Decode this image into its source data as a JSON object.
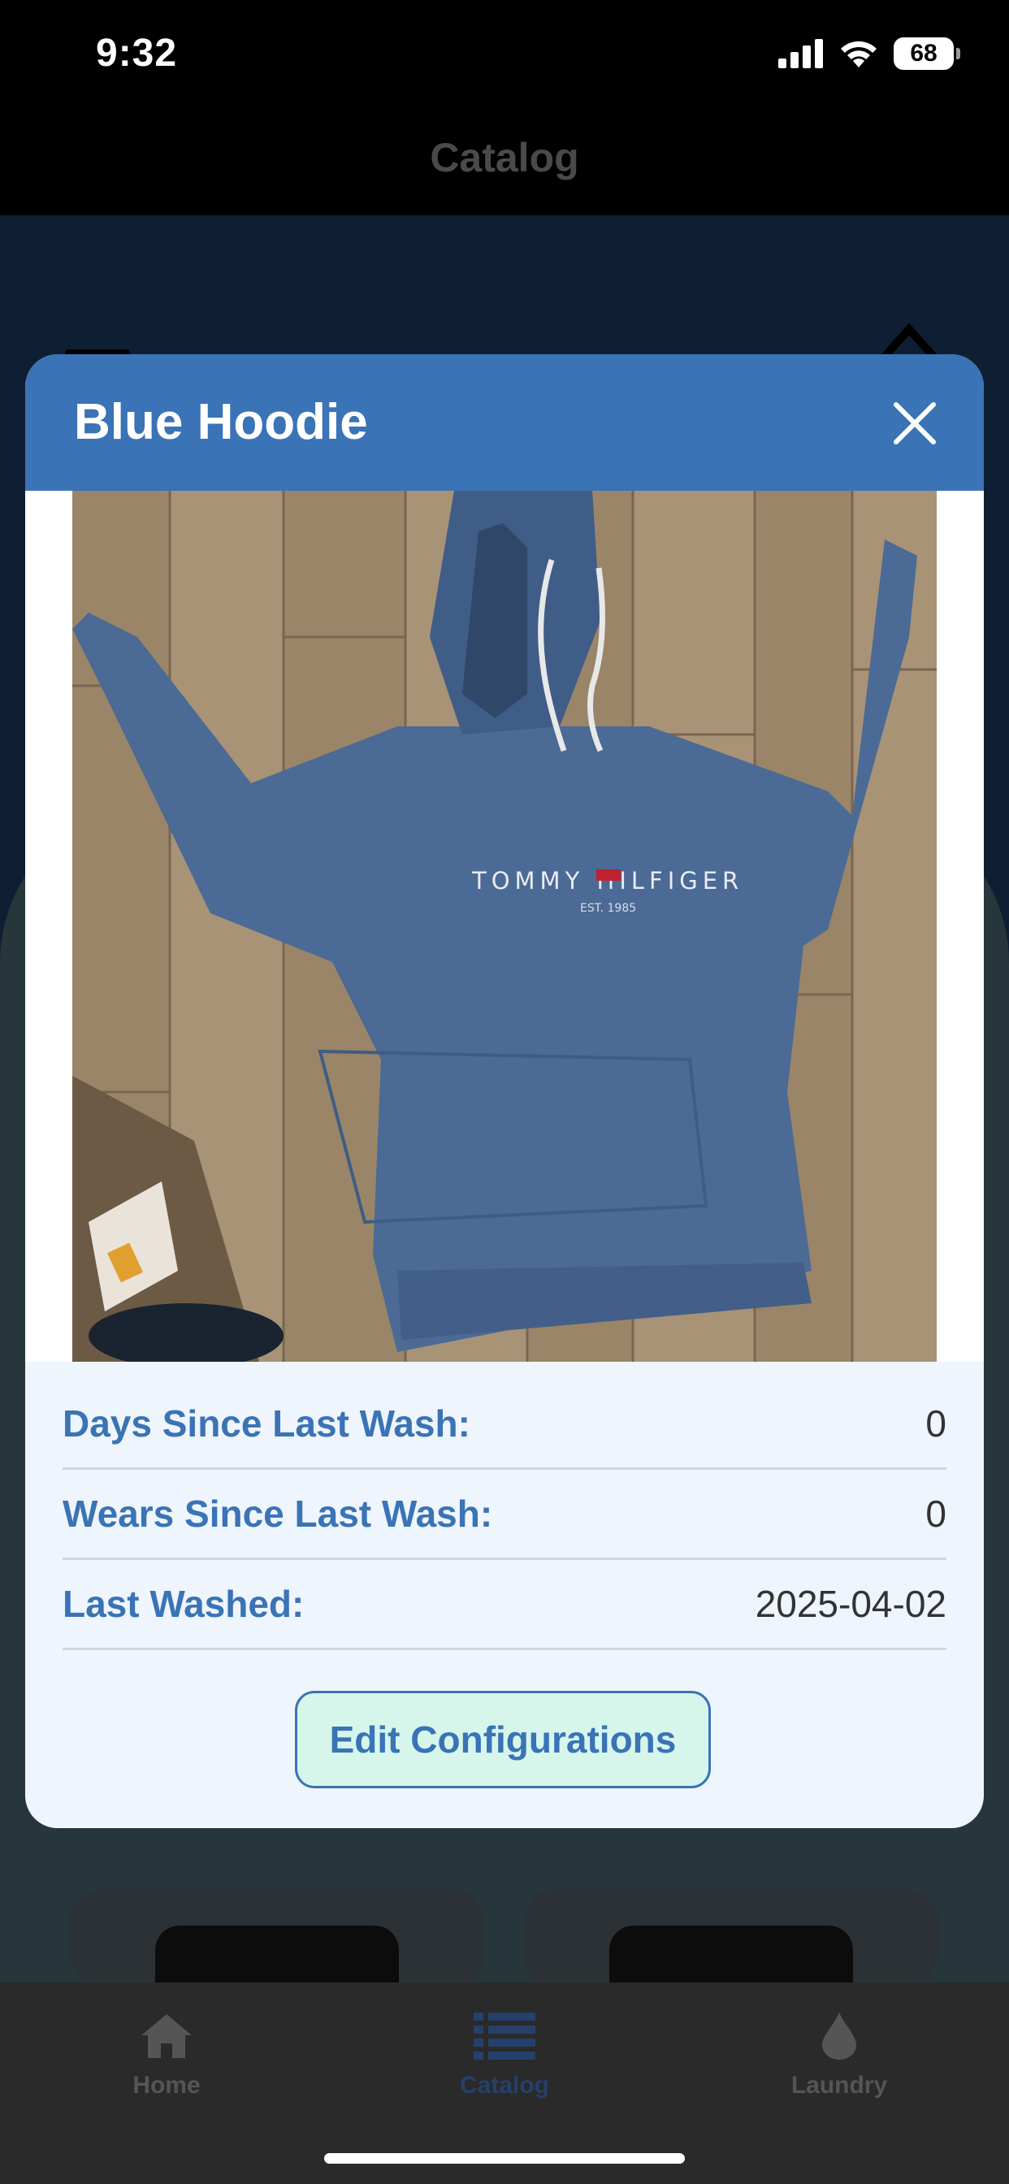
{
  "status_bar": {
    "time": "9:32",
    "battery": "68"
  },
  "nav": {
    "title": "Catalog"
  },
  "modal": {
    "title": "Blue Hoodie",
    "stats": [
      {
        "label": "Days Since Last Wash:",
        "value": "0"
      },
      {
        "label": "Wears Since Last Wash:",
        "value": "0"
      },
      {
        "label": "Last Washed:",
        "value": "2025-04-02"
      }
    ],
    "edit_button": "Edit Configurations",
    "photo": {
      "brand_text": "TOMMY HILFIGER",
      "est_text": "EST. 1985"
    }
  },
  "tabs": [
    {
      "label": "Home",
      "icon": "house-icon"
    },
    {
      "label": "Catalog",
      "icon": "list-icon",
      "active": true
    },
    {
      "label": "Laundry",
      "icon": "drop-icon"
    }
  ],
  "colors": {
    "header": "#3a73b6",
    "accent": "#3a73b6",
    "button_bg": "#d6f6ec"
  }
}
